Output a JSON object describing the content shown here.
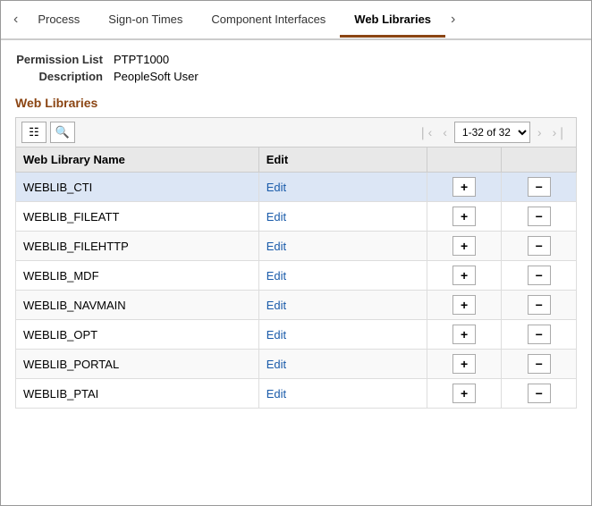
{
  "tabs": [
    {
      "id": "process",
      "label": "Process",
      "active": false
    },
    {
      "id": "signon-times",
      "label": "Sign-on Times",
      "active": false
    },
    {
      "id": "component-interfaces",
      "label": "Component Interfaces",
      "active": false
    },
    {
      "id": "web-libraries",
      "label": "Web Libraries",
      "active": true
    }
  ],
  "nav": {
    "prev_label": "<",
    "next_label": ">"
  },
  "meta": {
    "permission_list_label": "Permission List",
    "permission_list_value": "PTPT1000",
    "description_label": "Description",
    "description_value": "PeopleSoft User"
  },
  "section_title": "Web Libraries",
  "toolbar": {
    "grid_icon": "▦",
    "search_icon": "🔍"
  },
  "pagination": {
    "first_label": "⟨",
    "prev_label": "‹",
    "range": "1-32 of 32",
    "next_label": "›",
    "last_label": "⟩"
  },
  "table": {
    "columns": [
      {
        "id": "name",
        "label": "Web Library Name"
      },
      {
        "id": "edit",
        "label": "Edit"
      },
      {
        "id": "add",
        "label": ""
      },
      {
        "id": "remove",
        "label": ""
      }
    ],
    "rows": [
      {
        "name": "WEBLIB_CTI",
        "edit": "Edit"
      },
      {
        "name": "WEBLIB_FILEATT",
        "edit": "Edit"
      },
      {
        "name": "WEBLIB_FILEHTTP",
        "edit": "Edit"
      },
      {
        "name": "WEBLIB_MDF",
        "edit": "Edit"
      },
      {
        "name": "WEBLIB_NAVMAIN",
        "edit": "Edit"
      },
      {
        "name": "WEBLIB_OPT",
        "edit": "Edit"
      },
      {
        "name": "WEBLIB_PORTAL",
        "edit": "Edit"
      },
      {
        "name": "WEBLIB_PTAI",
        "edit": "Edit"
      }
    ],
    "add_label": "+",
    "remove_label": "−"
  }
}
